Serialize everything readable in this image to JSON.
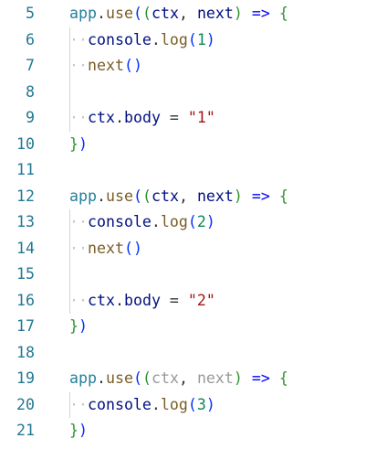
{
  "editor": {
    "lines": [
      {
        "num": "5",
        "tokens": [
          {
            "t": "app",
            "k": "t-app"
          },
          {
            "t": ".",
            "k": "t-punct"
          },
          {
            "t": "use",
            "k": "t-method"
          },
          {
            "t": "(",
            "k": "t-paren1"
          },
          {
            "t": "(",
            "k": "t-paren2"
          },
          {
            "t": "ctx",
            "k": "t-param"
          },
          {
            "t": ", ",
            "k": "t-punct"
          },
          {
            "t": "next",
            "k": "t-param"
          },
          {
            "t": ")",
            "k": "t-paren2"
          },
          {
            "t": " ",
            "k": "t-punct"
          },
          {
            "t": "=>",
            "k": "t-arrow"
          },
          {
            "t": " ",
            "k": "t-punct"
          },
          {
            "t": "{",
            "k": "t-paren2"
          }
        ]
      },
      {
        "num": "6",
        "guide": true,
        "tokens": [
          {
            "t": "··",
            "k": "ws"
          },
          {
            "t": "console",
            "k": "t-var"
          },
          {
            "t": ".",
            "k": "t-punct"
          },
          {
            "t": "log",
            "k": "t-fn"
          },
          {
            "t": "(",
            "k": "t-paren1"
          },
          {
            "t": "1",
            "k": "t-num"
          },
          {
            "t": ")",
            "k": "t-paren1"
          }
        ]
      },
      {
        "num": "7",
        "guide": true,
        "tokens": [
          {
            "t": "··",
            "k": "ws"
          },
          {
            "t": "next",
            "k": "t-fn"
          },
          {
            "t": "()",
            "k": "t-paren1"
          }
        ]
      },
      {
        "num": "8",
        "guide": true,
        "tokens": []
      },
      {
        "num": "9",
        "guide": true,
        "tokens": [
          {
            "t": "··",
            "k": "ws"
          },
          {
            "t": "ctx",
            "k": "t-var"
          },
          {
            "t": ".",
            "k": "t-punct"
          },
          {
            "t": "body",
            "k": "t-var"
          },
          {
            "t": " = ",
            "k": "t-punct"
          },
          {
            "t": "\"1\"",
            "k": "t-str"
          }
        ]
      },
      {
        "num": "10",
        "tokens": [
          {
            "t": "}",
            "k": "t-paren2"
          },
          {
            "t": ")",
            "k": "t-paren1"
          }
        ]
      },
      {
        "num": "11",
        "tokens": []
      },
      {
        "num": "12",
        "tokens": [
          {
            "t": "app",
            "k": "t-app"
          },
          {
            "t": ".",
            "k": "t-punct"
          },
          {
            "t": "use",
            "k": "t-method"
          },
          {
            "t": "(",
            "k": "t-paren1"
          },
          {
            "t": "(",
            "k": "t-paren2"
          },
          {
            "t": "ctx",
            "k": "t-param"
          },
          {
            "t": ", ",
            "k": "t-punct"
          },
          {
            "t": "next",
            "k": "t-param"
          },
          {
            "t": ")",
            "k": "t-paren2"
          },
          {
            "t": " ",
            "k": "t-punct"
          },
          {
            "t": "=>",
            "k": "t-arrow"
          },
          {
            "t": " ",
            "k": "t-punct"
          },
          {
            "t": "{",
            "k": "t-paren2"
          }
        ]
      },
      {
        "num": "13",
        "guide": true,
        "tokens": [
          {
            "t": "··",
            "k": "ws"
          },
          {
            "t": "console",
            "k": "t-var"
          },
          {
            "t": ".",
            "k": "t-punct"
          },
          {
            "t": "log",
            "k": "t-fn"
          },
          {
            "t": "(",
            "k": "t-paren1"
          },
          {
            "t": "2",
            "k": "t-num"
          },
          {
            "t": ")",
            "k": "t-paren1"
          }
        ]
      },
      {
        "num": "14",
        "guide": true,
        "tokens": [
          {
            "t": "··",
            "k": "ws"
          },
          {
            "t": "next",
            "k": "t-fn"
          },
          {
            "t": "()",
            "k": "t-paren1"
          }
        ]
      },
      {
        "num": "15",
        "guide": true,
        "tokens": []
      },
      {
        "num": "16",
        "guide": true,
        "tokens": [
          {
            "t": "··",
            "k": "ws"
          },
          {
            "t": "ctx",
            "k": "t-var"
          },
          {
            "t": ".",
            "k": "t-punct"
          },
          {
            "t": "body",
            "k": "t-var"
          },
          {
            "t": " = ",
            "k": "t-punct"
          },
          {
            "t": "\"2\"",
            "k": "t-str"
          }
        ]
      },
      {
        "num": "17",
        "tokens": [
          {
            "t": "}",
            "k": "t-paren2"
          },
          {
            "t": ")",
            "k": "t-paren1"
          }
        ]
      },
      {
        "num": "18",
        "tokens": []
      },
      {
        "num": "19",
        "tokens": [
          {
            "t": "app",
            "k": "t-app"
          },
          {
            "t": ".",
            "k": "t-punct"
          },
          {
            "t": "use",
            "k": "t-method"
          },
          {
            "t": "(",
            "k": "t-paren1"
          },
          {
            "t": "(",
            "k": "t-paren2"
          },
          {
            "t": "ctx",
            "k": "t-param-dim"
          },
          {
            "t": ", ",
            "k": "t-punct"
          },
          {
            "t": "next",
            "k": "t-param-dim"
          },
          {
            "t": ")",
            "k": "t-paren2"
          },
          {
            "t": " ",
            "k": "t-punct"
          },
          {
            "t": "=>",
            "k": "t-arrow"
          },
          {
            "t": " ",
            "k": "t-punct"
          },
          {
            "t": "{",
            "k": "t-paren2"
          }
        ]
      },
      {
        "num": "20",
        "guide": true,
        "tokens": [
          {
            "t": "··",
            "k": "ws"
          },
          {
            "t": "console",
            "k": "t-var"
          },
          {
            "t": ".",
            "k": "t-punct"
          },
          {
            "t": "log",
            "k": "t-fn"
          },
          {
            "t": "(",
            "k": "t-paren1"
          },
          {
            "t": "3",
            "k": "t-num"
          },
          {
            "t": ")",
            "k": "t-paren1"
          }
        ]
      },
      {
        "num": "21",
        "tokens": [
          {
            "t": "}",
            "k": "t-paren2"
          },
          {
            "t": ")",
            "k": "t-paren1"
          }
        ]
      }
    ]
  },
  "colors": {
    "line_number": "#237893",
    "background": "#ffffff",
    "indent_guide": "#d3d3d3"
  }
}
